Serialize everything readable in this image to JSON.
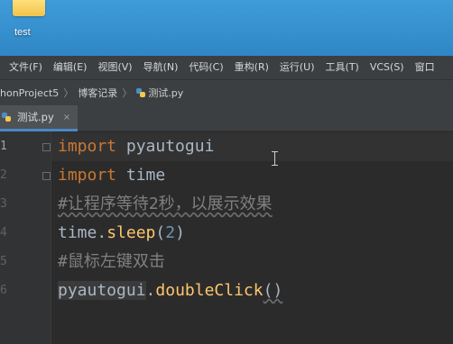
{
  "desktop": {
    "icon_label": "test"
  },
  "menu": {
    "items": [
      "文件(F)",
      "编辑(E)",
      "视图(V)",
      "导航(N)",
      "代码(C)",
      "重构(R)",
      "运行(U)",
      "工具(T)",
      "VCS(S)",
      "窗口"
    ]
  },
  "breadcrumb": {
    "project": "honProject5",
    "folder": "博客记录",
    "file": "测试.py"
  },
  "tab": {
    "label": "测试.py",
    "close_glyph": "×"
  },
  "editor": {
    "line_numbers": [
      "1",
      "2",
      "3",
      "4",
      "5",
      "6"
    ],
    "lines": [
      {
        "kw": "import",
        "rest": " pyautogui"
      },
      {
        "kw": "import",
        "rest": " time"
      },
      {
        "comment": "#让程序等待2秒，以展示效果"
      },
      {
        "obj": "time",
        "dot": ".",
        "fn": "sleep",
        "open": "(",
        "num": "2",
        "close": ")"
      },
      {
        "comment": "#鼠标左键双击"
      },
      {
        "obj": "pyautogui",
        "dot": ".",
        "fn": "doubleClick",
        "parens": "()"
      }
    ]
  },
  "icons": [
    "folder-icon",
    "python-file-icon",
    "breadcrumb-chevron-icon",
    "close-icon",
    "fold-marker-icon",
    "text-cursor-icon"
  ]
}
